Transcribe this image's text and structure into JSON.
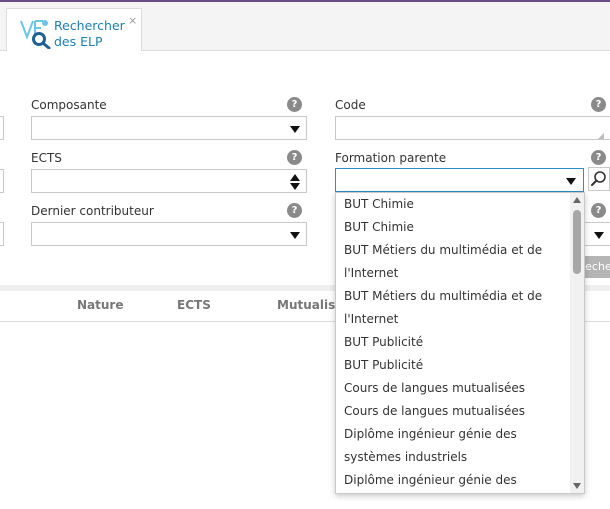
{
  "tab": {
    "label": "Rechercher des ELP",
    "close": "×"
  },
  "form": {
    "composante": {
      "label": "Composante",
      "value": ""
    },
    "code": {
      "label": "Code",
      "value": ""
    },
    "ects": {
      "label": "ECTS",
      "value": ""
    },
    "formation_parente": {
      "label": "Formation parente",
      "value": ""
    },
    "dernier_contributeur": {
      "label": "Dernier contributeur",
      "value": ""
    },
    "help": "?",
    "search_button": "Rechercher"
  },
  "grid": {
    "columns": [
      "Nature",
      "ECTS",
      "Mutualisé"
    ]
  },
  "dropdown": {
    "items": [
      "BUT Chimie",
      "BUT Chimie",
      "BUT Métiers du multimédia et de l'Internet",
      "BUT Métiers du multimédia et de l'Internet",
      "BUT Publicité",
      "BUT Publicité",
      "Cours de langues mutualisées",
      "Cours de langues mutualisées",
      "Diplôme ingénieur génie des systèmes industriels",
      "Diplôme ingénieur génie des systèmes industriels"
    ]
  },
  "colors": {
    "accent": "#1c7fb5",
    "topline": "#6b4a8a",
    "active_border": "#2a8fc4"
  },
  "icons": {
    "tab": "elp-search-icon",
    "help": "help-icon",
    "search": "magnifier-icon"
  }
}
